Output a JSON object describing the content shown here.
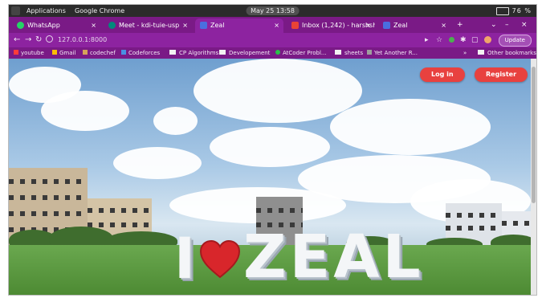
{
  "sysbar": {
    "applications": "Applications",
    "active_app": "Google Chrome",
    "clock": "May 25 13:58",
    "battery": "76 %"
  },
  "tabs": [
    {
      "label": "WhatsApp",
      "icon_color": "#25d366"
    },
    {
      "label": "Meet - kdi-tuie-usp",
      "icon_color": "#00897b"
    },
    {
      "label": "Zeal",
      "icon_color": "#4a6ee0"
    },
    {
      "label": "Inbox (1,242) - harshsh",
      "icon_color": "#ea4335"
    },
    {
      "label": "Zeal",
      "icon_color": "#4a6ee0"
    }
  ],
  "window_controls": {
    "new_tab": "+",
    "minimize": "–",
    "close": "×"
  },
  "address": {
    "url": "127.0.0.1:8000",
    "update_label": "Update"
  },
  "bookmarks": [
    {
      "label": "youtube",
      "icon": "youtube-icon"
    },
    {
      "label": "Gmail",
      "icon": "gmail-icon"
    },
    {
      "label": "codechef",
      "icon": "codechef-icon"
    },
    {
      "label": "Codeforces",
      "icon": "codeforces-icon"
    },
    {
      "label": "CP Algorithms",
      "icon": "folder-icon"
    },
    {
      "label": "Developement",
      "icon": "folder-icon"
    },
    {
      "label": "AtCoder Probl...",
      "icon": "atcoder-icon"
    },
    {
      "label": "sheets",
      "icon": "folder-icon"
    },
    {
      "label": "Yet Another R...",
      "icon": "bookmark-icon"
    },
    {
      "label": "Other bookmarks",
      "icon": "folder-icon"
    }
  ],
  "page": {
    "login_label": "Log in",
    "register_label": "Register",
    "sign": {
      "first": "I",
      "rest": "ZEAL"
    }
  },
  "colors": {
    "tabbar": "#7a1a86",
    "toolbar": "#8d23a0",
    "button": "#e8413f"
  }
}
